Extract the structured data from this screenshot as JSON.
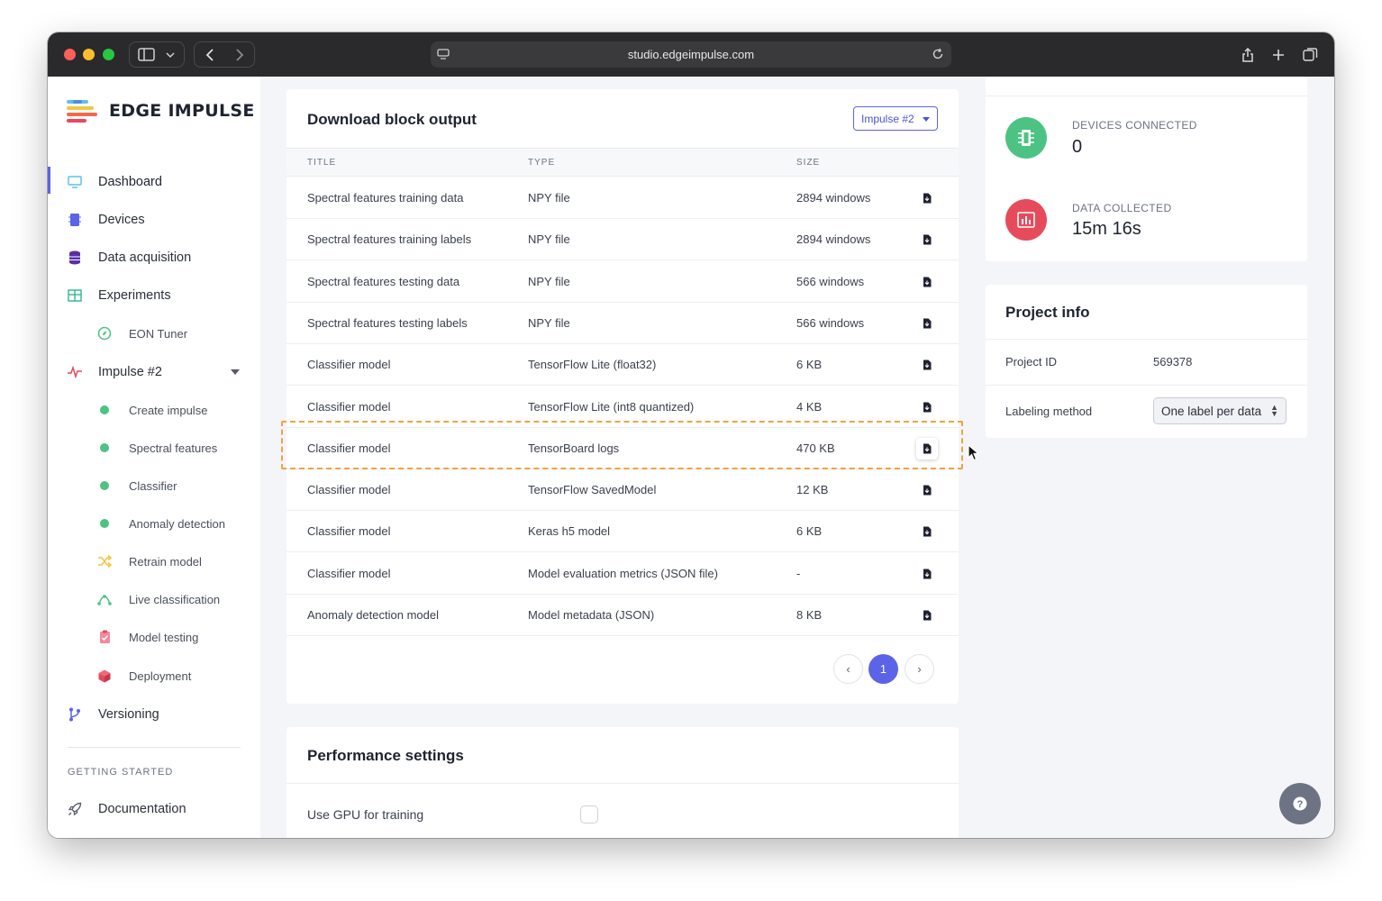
{
  "browser": {
    "url": "studio.edgeimpulse.com"
  },
  "sidebar": {
    "logo_text": "EDGE IMPULSE",
    "items": [
      {
        "label": "Dashboard"
      },
      {
        "label": "Devices"
      },
      {
        "label": "Data acquisition"
      },
      {
        "label": "Experiments"
      },
      {
        "label": "EON Tuner"
      },
      {
        "label": "Impulse #2"
      },
      {
        "label": "Create impulse"
      },
      {
        "label": "Spectral features"
      },
      {
        "label": "Classifier"
      },
      {
        "label": "Anomaly detection"
      },
      {
        "label": "Retrain model"
      },
      {
        "label": "Live classification"
      },
      {
        "label": "Model testing"
      },
      {
        "label": "Deployment"
      },
      {
        "label": "Versioning"
      }
    ],
    "section_title": "GETTING STARTED",
    "documentation": "Documentation"
  },
  "download": {
    "title": "Download block output",
    "impulse_select": "Impulse #2",
    "headers": {
      "title": "TITLE",
      "type": "TYPE",
      "size": "SIZE"
    },
    "rows": [
      {
        "title": "Spectral features training data",
        "type": "NPY file",
        "size": "2894 windows"
      },
      {
        "title": "Spectral features training labels",
        "type": "NPY file",
        "size": "2894 windows"
      },
      {
        "title": "Spectral features testing data",
        "type": "NPY file",
        "size": "566 windows"
      },
      {
        "title": "Spectral features testing labels",
        "type": "NPY file",
        "size": "566 windows"
      },
      {
        "title": "Classifier model",
        "type": "TensorFlow Lite (float32)",
        "size": "6 KB"
      },
      {
        "title": "Classifier model",
        "type": "TensorFlow Lite (int8 quantized)",
        "size": "4 KB"
      },
      {
        "title": "Classifier model",
        "type": "TensorBoard logs",
        "size": "470 KB"
      },
      {
        "title": "Classifier model",
        "type": "TensorFlow SavedModel",
        "size": "12 KB"
      },
      {
        "title": "Classifier model",
        "type": "Keras h5 model",
        "size": "6 KB"
      },
      {
        "title": "Classifier model",
        "type": "Model evaluation metrics (JSON file)",
        "size": "-"
      },
      {
        "title": "Anomaly detection model",
        "type": "Model metadata (JSON)",
        "size": "8 KB"
      }
    ],
    "pagination": {
      "prev": "‹",
      "current": "1",
      "next": "›"
    }
  },
  "performance": {
    "title": "Performance settings",
    "gpu_label": "Use GPU for training"
  },
  "stats": {
    "devices_label": "DEVICES CONNECTED",
    "devices_value": "0",
    "data_label": "DATA COLLECTED",
    "data_value": "15m 16s"
  },
  "project_info": {
    "title": "Project info",
    "id_label": "Project ID",
    "id_value": "569378",
    "labeling_label": "Labeling method",
    "labeling_value": "One label per data"
  },
  "help": {
    "label": "?"
  },
  "colors": {
    "accent": "#5b63e6",
    "devices_green": "#4cc382",
    "data_red": "#e64b5c",
    "highlight_orange": "#f0a340"
  }
}
